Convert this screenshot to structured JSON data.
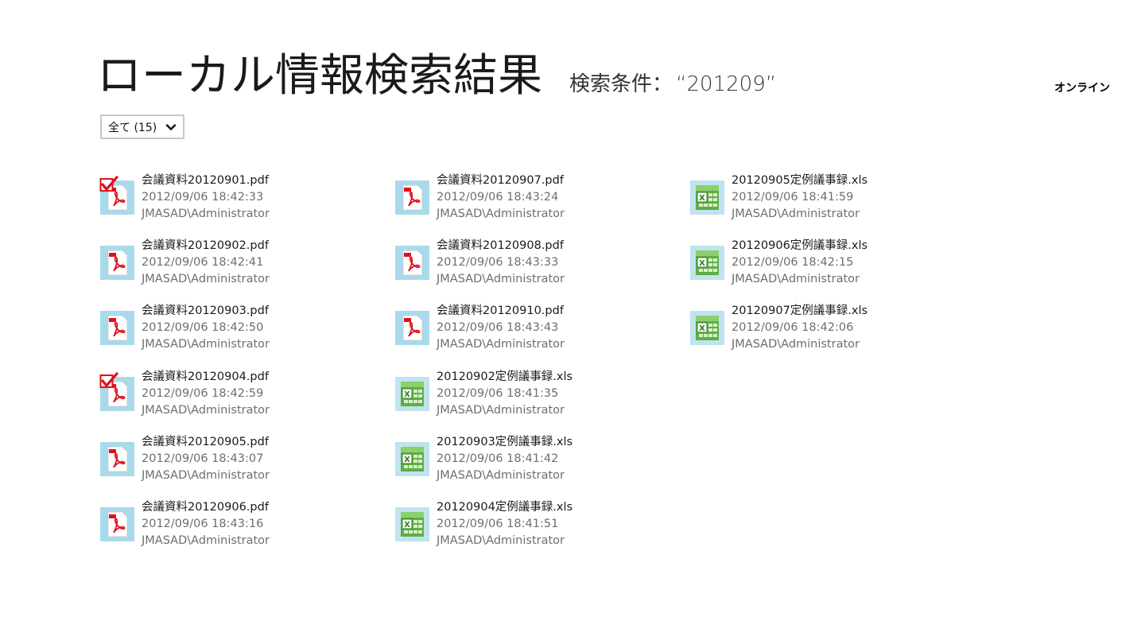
{
  "header": {
    "title": "ローカル情報検索結果",
    "condition_label": "検索条件：",
    "condition_query": "“201209”"
  },
  "top_right_link": "オンライン",
  "filter": {
    "label": "全て (15)"
  },
  "colors": {
    "pdf_bg": "#a9daec",
    "xls_green": "#3f9e2f",
    "check_red": "#e0101a"
  },
  "results": [
    {
      "icon": "pdf-file-icon",
      "checked": true,
      "name": "会議資料20120901.pdf",
      "date": "2012/09/06 18:42:33",
      "author": "JMASAD\\Administrator"
    },
    {
      "icon": "pdf-file-icon",
      "checked": false,
      "name": "会議資料20120902.pdf",
      "date": "2012/09/06 18:42:41",
      "author": "JMASAD\\Administrator"
    },
    {
      "icon": "pdf-file-icon",
      "checked": false,
      "name": "会議資料20120903.pdf",
      "date": "2012/09/06 18:42:50",
      "author": "JMASAD\\Administrator"
    },
    {
      "icon": "pdf-file-icon",
      "checked": true,
      "name": "会議資料20120904.pdf",
      "date": "2012/09/06 18:42:59",
      "author": "JMASAD\\Administrator"
    },
    {
      "icon": "pdf-file-icon",
      "checked": false,
      "name": "会議資料20120905.pdf",
      "date": "2012/09/06 18:43:07",
      "author": "JMASAD\\Administrator"
    },
    {
      "icon": "pdf-file-icon",
      "checked": false,
      "name": "会議資料20120906.pdf",
      "date": "2012/09/06 18:43:16",
      "author": "JMASAD\\Administrator"
    },
    {
      "icon": "pdf-file-icon",
      "checked": false,
      "name": "会議資料20120907.pdf",
      "date": "2012/09/06 18:43:24",
      "author": "JMASAD\\Administrator"
    },
    {
      "icon": "pdf-file-icon",
      "checked": false,
      "name": "会議資料20120908.pdf",
      "date": "2012/09/06 18:43:33",
      "author": "JMASAD\\Administrator"
    },
    {
      "icon": "pdf-file-icon",
      "checked": false,
      "name": "会議資料20120910.pdf",
      "date": "2012/09/06 18:43:43",
      "author": "JMASAD\\Administrator"
    },
    {
      "icon": "excel-file-icon",
      "checked": false,
      "name": "20120902定例議事録.xls",
      "date": "2012/09/06 18:41:35",
      "author": "JMASAD\\Administrator"
    },
    {
      "icon": "excel-file-icon",
      "checked": false,
      "name": "20120903定例議事録.xls",
      "date": "2012/09/06 18:41:42",
      "author": "JMASAD\\Administrator"
    },
    {
      "icon": "excel-file-icon",
      "checked": false,
      "name": "20120904定例議事録.xls",
      "date": "2012/09/06 18:41:51",
      "author": "JMASAD\\Administrator"
    },
    {
      "icon": "excel-file-icon",
      "checked": false,
      "name": "20120905定例議事録.xls",
      "date": "2012/09/06 18:41:59",
      "author": "JMASAD\\Administrator"
    },
    {
      "icon": "excel-file-icon",
      "checked": false,
      "name": "20120906定例議事録.xls",
      "date": "2012/09/06 18:42:15",
      "author": "JMASAD\\Administrator"
    },
    {
      "icon": "excel-file-icon",
      "checked": false,
      "name": "20120907定例議事録.xls",
      "date": "2012/09/06 18:42:06",
      "author": "JMASAD\\Administrator"
    }
  ]
}
